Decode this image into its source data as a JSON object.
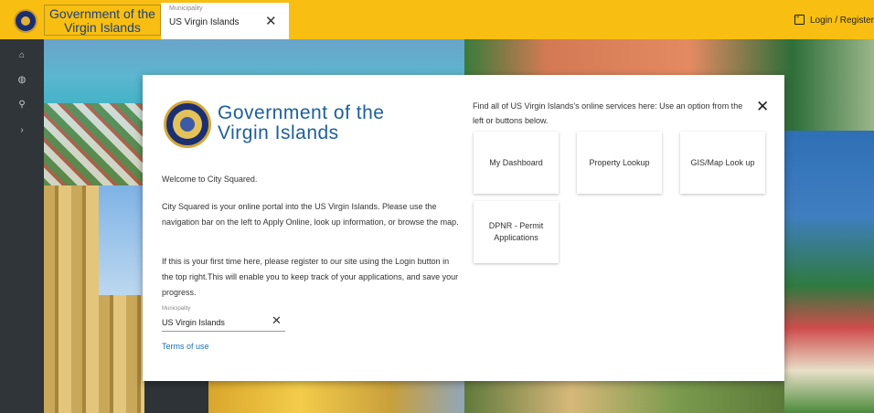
{
  "topbar": {
    "title": "Government of the Virgin Islands",
    "municipality_caption": "Municipality",
    "municipality_value": "US Virgin Islands",
    "clear_symbol": "✕",
    "login_label": "Login / Register"
  },
  "sidebar": {
    "items": [
      {
        "icon": "home-icon",
        "glyph": "⌂"
      },
      {
        "icon": "globe-icon",
        "glyph": "◍"
      },
      {
        "icon": "search-icon",
        "glyph": "⚲"
      },
      {
        "icon": "chevron-right-icon",
        "glyph": "›"
      }
    ]
  },
  "dialog": {
    "title": "Government of the Virgin Islands",
    "welcome": "Welcome to City Squared.",
    "paragraph1": "City Squared is your online portal into the US Virgin Islands. Please use the navigation bar on the left to Apply Online, look up information, or browse the map.",
    "paragraph2": "If this is your first time here, please register to our site using the Login button in the top right.This will enable you to keep track of your applications, and save your progress.",
    "municipality_caption": "Municipality",
    "municipality_value": "US Virgin Islands",
    "clear_symbol": "✕",
    "terms_label": "Terms of use",
    "find_text": "Find all of US Virgin Islands's online services here: Use an option from the left or buttons below.",
    "close_symbol": "✕",
    "services": [
      "My Dashboard",
      "Property Lookup",
      "GIS/Map Look up",
      "DPNR - Permit Applications"
    ]
  },
  "colors": {
    "topbar": "#f8bf12",
    "sidebar": "#2f3538",
    "title_blue": "#1c5f9b",
    "link_blue": "#1c6fb0"
  }
}
